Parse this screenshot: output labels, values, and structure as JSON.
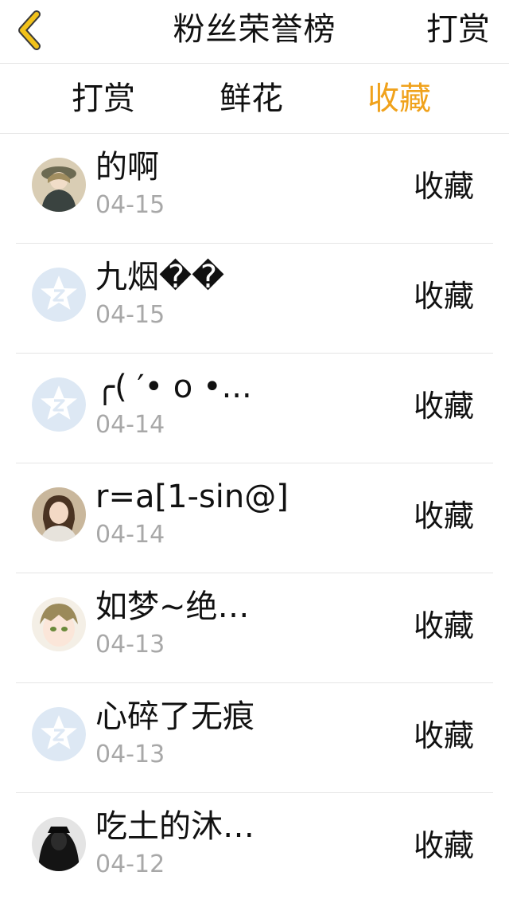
{
  "header": {
    "title": "粉丝荣誉榜",
    "action_label": "打赏",
    "back_icon": "chevron-left-icon",
    "back_color": "#f2c21a"
  },
  "tabs": [
    {
      "label": "打赏",
      "active": false
    },
    {
      "label": "鲜花",
      "active": false
    },
    {
      "label": "收藏",
      "active": true
    }
  ],
  "colors": {
    "accent": "#f0a21c",
    "date_gray": "#a8a8a8",
    "divider": "#e5e5e5"
  },
  "list": [
    {
      "name": "的啊",
      "date": "04-15",
      "type": "收藏",
      "avatar": "photo-avatar"
    },
    {
      "name": "九烟��",
      "date": "04-15",
      "type": "收藏",
      "avatar": "default-avatar"
    },
    {
      "name": "╭( ′• o •...",
      "date": "04-14",
      "type": "收藏",
      "avatar": "default-avatar"
    },
    {
      "name": "r=a[1-sin@]",
      "date": "04-14",
      "type": "收藏",
      "avatar": "photo-avatar"
    },
    {
      "name": "如梦~绝…",
      "date": "04-13",
      "type": "收藏",
      "avatar": "photo-avatar"
    },
    {
      "name": "心碎了无痕",
      "date": "04-13",
      "type": "收藏",
      "avatar": "default-avatar"
    },
    {
      "name": "吃土的沐…",
      "date": "04-12",
      "type": "收藏",
      "avatar": "photo-avatar"
    }
  ]
}
